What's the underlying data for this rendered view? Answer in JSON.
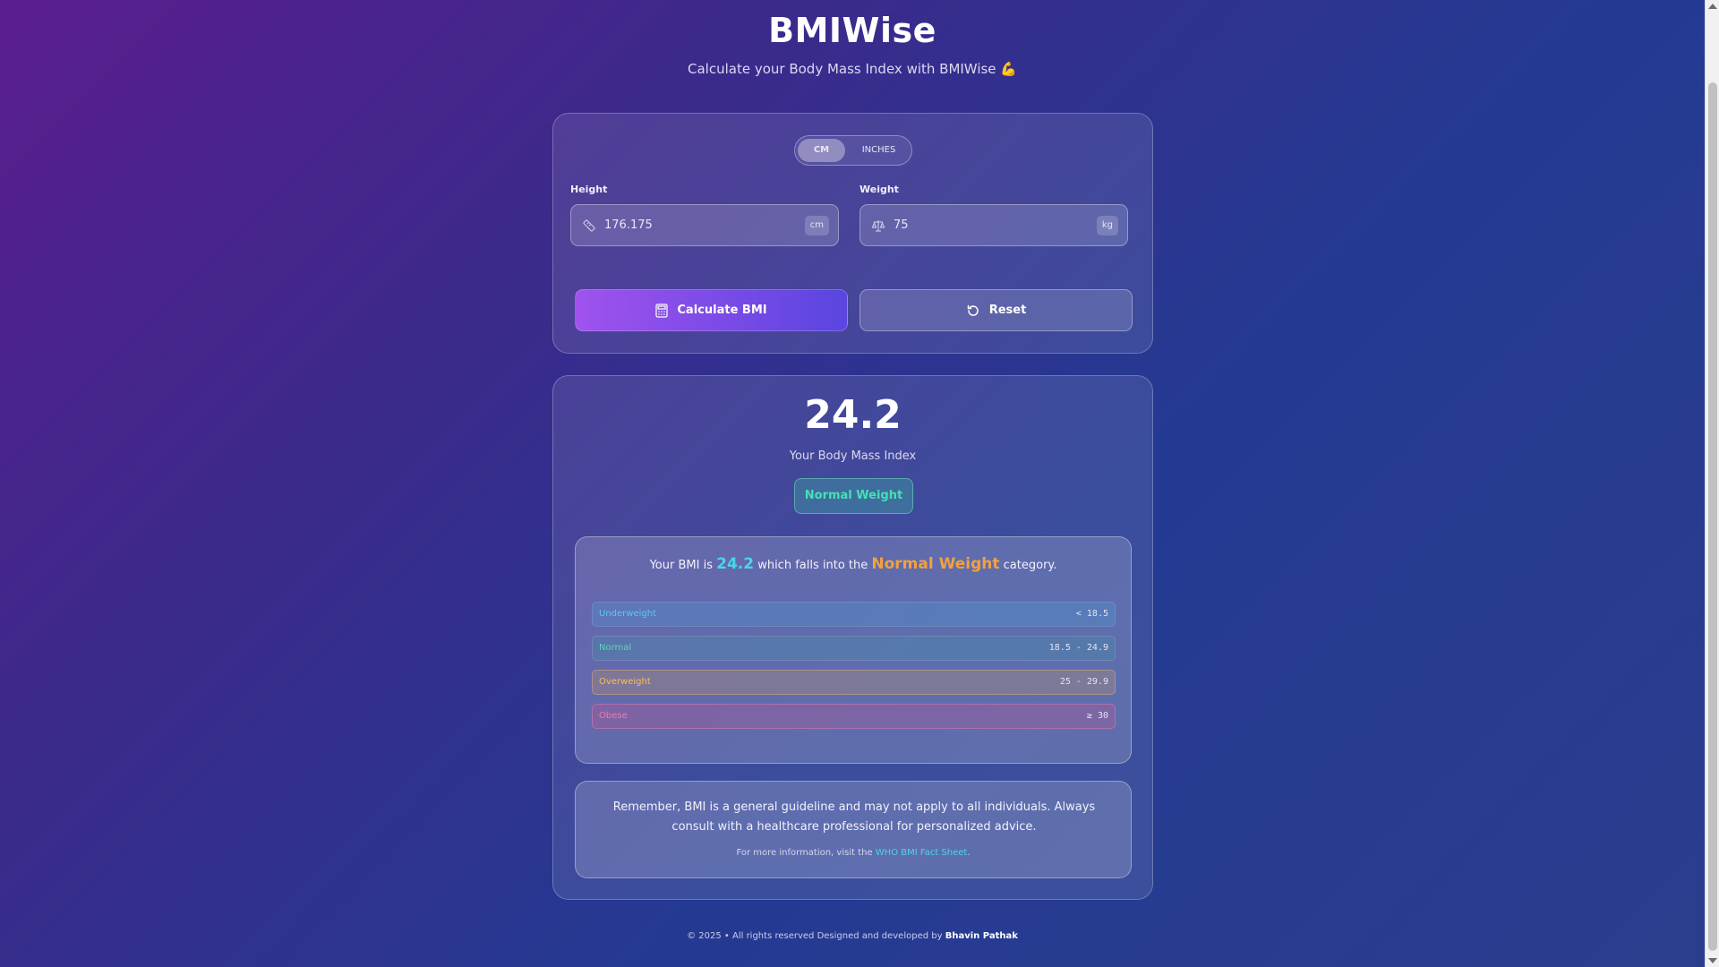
{
  "header": {
    "title": "BMIWise",
    "subtitle": "Calculate your Body Mass Index with BMIWise 💪"
  },
  "form": {
    "unit_options": [
      "CM",
      "INCHES"
    ],
    "selected_unit": "CM",
    "height_label": "Height",
    "height_value": "176.175",
    "height_unit": "cm",
    "weight_label": "Weight",
    "weight_value": "75",
    "weight_unit": "kg",
    "calculate_label": "Calculate BMI",
    "reset_label": "Reset"
  },
  "result": {
    "bmi": "24.2",
    "caption": "Your Body Mass Index",
    "category_badge": "Normal Weight",
    "summary_prefix": "Your BMI is",
    "summary_bmi": "24.2",
    "summary_middle": "which falls into the",
    "summary_category": "Normal Weight",
    "summary_suffix": "category.",
    "categories": [
      {
        "name": "Underweight",
        "range": "< 18.5",
        "color": "#5cc8ea"
      },
      {
        "name": "Normal",
        "range": "18.5 - 24.9",
        "color": "#5ad6b0"
      },
      {
        "name": "Overweight",
        "range": "25 - 29.9",
        "color": "#f3c05a"
      },
      {
        "name": "Obese",
        "range": "≥ 30",
        "color": "#f07aa8"
      }
    ],
    "note": "Remember, BMI is a general guideline and may not apply to all individuals. Always consult with a healthcare professional for personalized advice.",
    "more_info_prefix": "For more information, visit the",
    "more_info_link": "WHO BMI Fact Sheet",
    "more_info_suffix": "."
  },
  "footer": {
    "text": "© 2025 • All rights reserved Designed and developed by",
    "author": "Bhavin Pathak"
  },
  "colors": {
    "accent_bmi": "#4ad6e8",
    "accent_category": "#f3a13c",
    "badge_text": "#46e0b5"
  }
}
